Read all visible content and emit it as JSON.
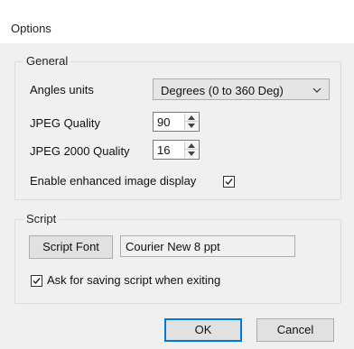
{
  "window": {
    "title": "Options"
  },
  "general": {
    "group_label": "General",
    "angles_units_label": "Angles units",
    "angles_units_value": "Degrees (0 to 360 Deg)",
    "jpeg_quality_label": "JPEG Quality",
    "jpeg_quality_value": "90",
    "jpeg2000_quality_label": "JPEG 2000 Quality",
    "jpeg2000_quality_value": "16",
    "enhanced_display_label": "Enable enhanced image display",
    "enhanced_display_checked": true
  },
  "script": {
    "group_label": "Script",
    "font_button_label": "Script Font",
    "font_value": "Courier New 8 ppt",
    "ask_saving_label": "Ask for saving script when exiting",
    "ask_saving_checked": true
  },
  "footer": {
    "ok_label": "OK",
    "cancel_label": "Cancel"
  },
  "colors": {
    "default_button_border": "#0078d7",
    "dialog_background": "#f0f0f0"
  },
  "icons": {
    "combo_arrow": "chevron-down-icon",
    "spin_up": "triangle-up-icon",
    "spin_down": "triangle-down-icon",
    "checkmark": "checkmark-icon"
  }
}
